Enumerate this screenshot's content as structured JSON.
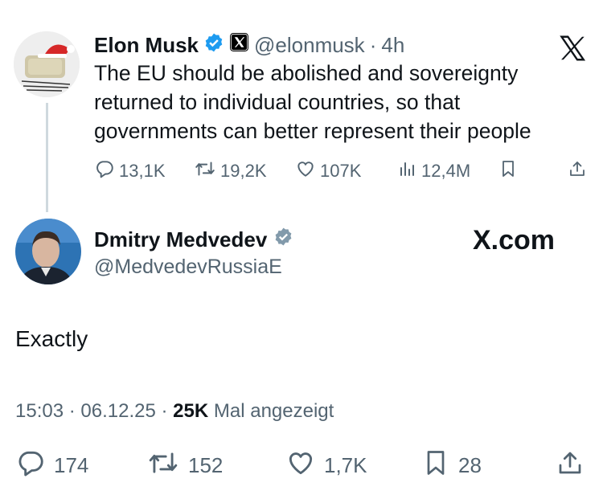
{
  "quoted_tweet": {
    "author_name": "Elon Musk",
    "handle": "@elonmusk",
    "separator": "·",
    "time": "4h",
    "text": "The EU should be abolished and sovereignty returned to individual countries, so that governments can better represent their people",
    "stats": {
      "replies": "13,1K",
      "reposts": "19,2K",
      "likes": "107K",
      "views": "12,4M"
    }
  },
  "tweet": {
    "author_name": "Dmitry Medvedev",
    "handle": "@MedvedevRussiaE",
    "site_watermark": "X.com",
    "text": "Exactly",
    "time": "15:03",
    "date": "06.12.25",
    "views_count": "25K",
    "views_label": "Mal angezeigt",
    "stats": {
      "replies": "174",
      "reposts": "152",
      "likes": "1,7K",
      "bookmarks": "28"
    }
  },
  "colors": {
    "verified_blue": "#1d9bf0",
    "verified_gray": "#829aab",
    "secondary_text": "#536471",
    "primary_text": "#0f1419"
  }
}
